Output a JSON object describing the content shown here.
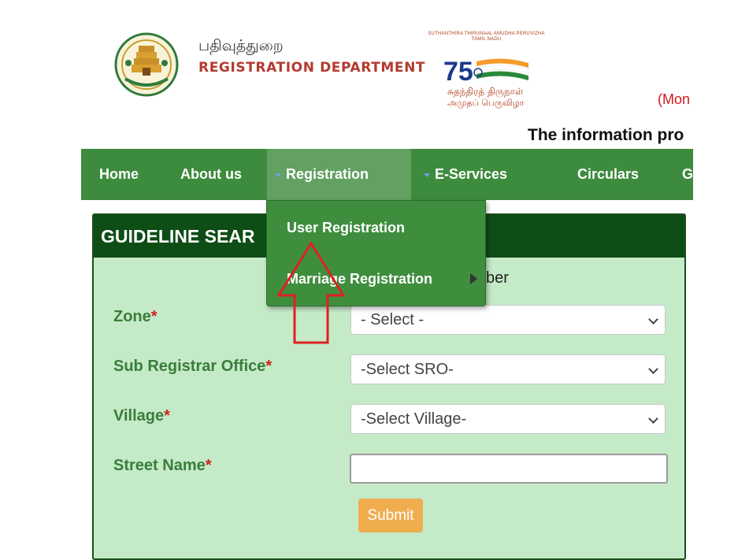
{
  "header": {
    "dept_tamil": "பதிவுத்துறை",
    "dept_english": "REGISTRATION DEPARTMENT",
    "anniversary": {
      "small_text": "SUTHANTHIRA THIRUNAAL AMUDHA PERUVIZHA TAMIL NADU",
      "number": "75",
      "tamil_line1": "சுதந்திரத் திருநாள்",
      "tamil_line2": "அமுதப் பெருவிழா"
    },
    "mon_text": "(Mon",
    "info_text": "The information pro"
  },
  "nav": {
    "items": [
      {
        "label": "Home"
      },
      {
        "label": "About us"
      },
      {
        "label": "Registration"
      },
      {
        "label": "E-Services"
      },
      {
        "label": "Circulars"
      },
      {
        "label": "G"
      }
    ]
  },
  "dropdown": {
    "items": [
      {
        "label": "User Registration"
      },
      {
        "label": "Marriage Registration"
      }
    ]
  },
  "panel": {
    "title": "GUIDELINE SEAR",
    "partial_text": "ber",
    "fields": [
      {
        "label": "Zone",
        "required_mark": "*",
        "value": "- Select -"
      },
      {
        "label": "Sub Registrar Office",
        "required_mark": "*",
        "value": "-Select SRO-"
      },
      {
        "label": "Village",
        "required_mark": "*",
        "value": "-Select Village-"
      },
      {
        "label": "Street Name",
        "required_mark": "*",
        "value": ""
      }
    ],
    "submit_label": "Submit"
  },
  "colors": {
    "nav_bg": "#3d8b3d",
    "nav_active_bg": "#62a162",
    "panel_bg": "#c4eac8",
    "panel_head_bg": "#0e4d16",
    "label_color": "#3a7d3a",
    "required_color": "#d42020",
    "submit_bg": "#f0ad4e",
    "annotation_arrow": "#e02020"
  }
}
